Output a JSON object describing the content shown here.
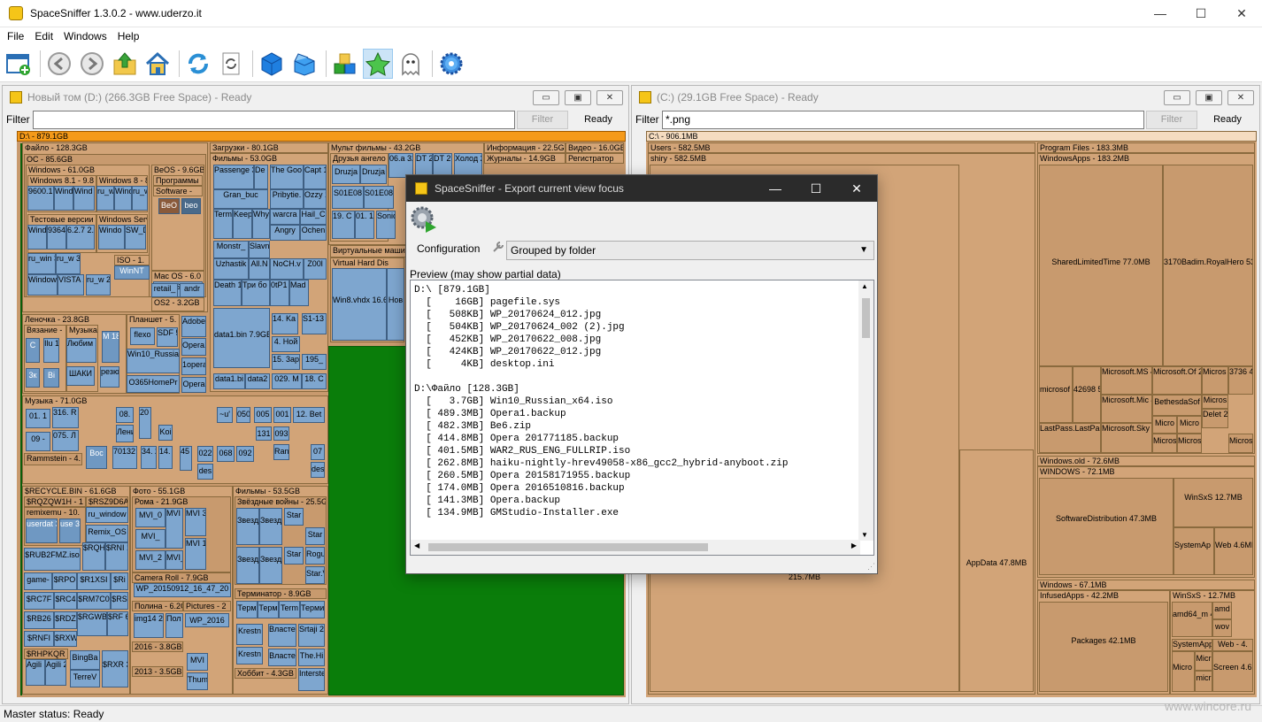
{
  "window": {
    "title": "SpaceSniffer 1.3.0.2 - www.uderzo.it",
    "minimize": "—",
    "maximize": "☐",
    "close": "✕"
  },
  "menu": [
    "File",
    "Edit",
    "Windows",
    "Help"
  ],
  "toolbar": {
    "icons": [
      "new-view-icon",
      "back-icon",
      "forward-icon",
      "up-folder-icon",
      "home-icon",
      "refresh-icon",
      "refresh-doc-icon",
      "blue-cube-icon",
      "blue-box-open-icon",
      "blocks-icon",
      "star-icon",
      "ghost-icon",
      "settings-gear-icon"
    ]
  },
  "left_panel": {
    "title": "Новый том (D:) (266.3GB Free Space) - Ready",
    "filter_label": "Filter",
    "filter_value": "",
    "filter_button": "Filter",
    "status": "Ready",
    "root": "D:\\ - 879.1GB",
    "blocks": [
      "Файло - 128.3GB",
      "OC - 85.6GB",
      "Windows - 61.0GB",
      "BeOS - 9.6GB",
      "Windows 8.1 - 9.8",
      "Windows 8 - 8.",
      "Программы",
      "Software -",
      "BeO",
      "beo",
      "9600.1 3.7GB",
      "Wind 3.0G",
      "Wind 2.9G",
      "ru_w 3.1G",
      "Wind 2.6G",
      "ru_w 3.0G",
      "Тестовые версии",
      "Windows Serve",
      "Windo 4.0GB",
      "SW_D 3.9GB",
      "Mac OS - 6.0",
      "MacOSX_10 4.6GB",
      "OS2 - 3.2GB",
      "Windows 2.8G",
      "9364 2.6G",
      "6.2.7 2.4G",
      "ru_win 3.4G",
      "ru_w 3.0G",
      "ISO - 1.",
      "WinNT",
      "retail_",
      "andr",
      "Windows 3.6GB",
      "VISTA 2.7G",
      "ru_w 2.3G",
      "Загрузки - 80.1GB",
      "Фильмы - 53.0GB",
      "Passenge 3.1GB",
      "De 2.1",
      "The Goo 1.9GB",
      "Capt 1.4G",
      "Gran_buc",
      "Pribytie.",
      "Ozzy 1.4G",
      "Term 2.1G",
      "Keep 2.1G",
      "Why 2.1G",
      "warcra",
      "Hail_C",
      "Angry",
      "Ochen",
      "Monstr_",
      "Slavn",
      "Uzhastik",
      "All.N",
      "NoCH.v",
      "Z00l",
      "Death 1.3GB",
      "Три бо 1.3GB",
      "0tP1 1.3GB",
      "Mad 1.3G",
      "data1.bin 7.9GB",
      "14. Ka 147.4",
      "S1-13 178.5",
      "4. Hoй",
      "15. 3ap",
      "195_",
      "data1.bi",
      "data2",
      "029. M",
      "18. C",
      "Мульт фильмы - 43.2GB",
      "Друзья ангело",
      "06.a 328",
      "DT 219",
      "DT 218",
      "Холод 2.1GB",
      "Druzja",
      "Druzja",
      "S01E08",
      "S01E08",
      "19. C 155.",
      "01. 153.",
      "Sonic 231.4",
      "Виртуальные машин",
      "Virtual Hard Dis",
      "Win8.vhdx 16.6GB",
      "Нов",
      "Информация - 22.5G",
      "Журналы - 14.9GB",
      "Видео - 16.0GB",
      "Регистратор",
      "Леночка - 23.8GB",
      "Вязание -",
      "Музыка",
      "Планшет - 5.",
      "Ilu 1.3",
      "Любим 268KB",
      "M 18",
      "flexo",
      "SDF 5.9M",
      "Win10_Russian 3.7GB",
      "1opera",
      "ШАКИ",
      "резю 84KB",
      "O365HomePr",
      "Opera",
      "Adobe 678.6",
      "Opera1",
      "Музыка - 71.0GB",
      "316. R 9.6MB",
      "01. 1",
      "075. Л 4.9MB",
      "09 -",
      "Rammstein - 4.",
      "Boc",
      "70132 1.8M",
      "34. 21",
      "14. 21",
      "08.",
      "Лени",
      "20 17",
      "Koi",
      "45 3.1",
      "022",
      "068",
      "092",
      "des",
      "~u'",
      "050",
      "005",
      "001",
      "12. Bet",
      "131",
      "093",
      "Ran",
      "07",
      "des",
      "$RECYCLE.BIN - 61.6GB",
      "$RQZQW1H - 1",
      "$RSZ9D6A",
      "remixemu - 10.",
      "ru_window",
      "userdat 3.8GB",
      "use 3.8",
      "Remix_OS",
      "$RUB2FMZ.iso",
      "$RQH 1.9G",
      "$RNI 1.9G",
      "game-",
      "$RPO",
      "$R1XSI",
      "$Ri",
      "$RC7F",
      "$RC4",
      "$RM7C0",
      "$RS",
      "$RB26",
      "$RDZ",
      "$RGWB 847MB",
      "$RF 636",
      "$RNFI",
      "$RXWL",
      "$RHPKQR",
      "Agili 3.0G",
      "Agili 2.9G",
      "BingBa",
      "TerreV",
      "$RXR 3.6GE",
      "Фото - 55.1GB",
      "Рома - 21.9GB",
      "MVI_0",
      "MVI_",
      "MVI 461",
      "MVI 339.6",
      "MVI_2",
      "MVI_",
      "MVI 197.8",
      "Camera Roll - 7.9GB",
      "WP_20150912_16_47_20",
      "Полина - 6.2G",
      "Pictures - 2",
      "img14 288KB",
      "Пол 12.",
      "WP_2016",
      "2016 - 3.8GB",
      "MVI",
      "2013 - 3.5GB",
      "Thum",
      "Фильмы - 53.5GB",
      "Звёздные войны - 25.5G",
      "Звезд 2.1GE",
      "Звезд 2.1GE",
      "Star",
      "Star",
      "Star",
      "Rogu",
      "Star.V",
      "Звезд 2.1GE",
      "Звезд 2.1GE",
      "Терминатор - 8.9GB",
      "Терм",
      "Терм",
      "Term",
      "Терми",
      "Krestn",
      "Власте 1.4GB",
      "Srtaji 2.1GB",
      "Krestn",
      "Власте",
      "The.Hi",
      "Хоббит - 4.3GB",
      "Interste 1.4GB"
    ]
  },
  "right_panel": {
    "title": "(C:) (29.1GB Free Space) - Ready",
    "filter_label": "Filter",
    "filter_value": "*.png",
    "filter_button": "Filter",
    "status": "Ready",
    "root": "C:\\ - 906.1MB",
    "blocks": [
      "Users - 582.5MB",
      "shiry - 582.5MB",
      "Program Files - 183.3MB",
      "WindowsApps - 183.2MB",
      "SharedLimitedTime 77.0MB",
      "3170Badim.RoyalHero 53.0MB",
      "microsof 6.0MB",
      "42698 5.1MB",
      "Microsoft.MS 4.4MB",
      "Microsoft.Of 2.9MB",
      "Micros 636KB",
      "3736 488K",
      "Microsoft.Mic 4.4MB",
      "BethesdaSof",
      "Micros",
      "Delet 280KI",
      "LastPass.LastPa 4.5MB",
      "Microsoft.Sky 4.1MB",
      "Micro",
      "Micro",
      "Micros",
      "Micros",
      "Micros",
      "Windows.old - 72.6MB",
      "WINDOWS - 72.1MB",
      "SoftwareDistribution 47.3MB",
      "WinSxS 12.7MB",
      "SystemAp 5.7MB",
      "Web 4.6MB",
      "Windows - 67.1MB",
      "InfusedApps - 42.2MB",
      "WinSxS - 12.7MB",
      "Packages 42.1MB",
      "amd64_m 4.6MB",
      "amd",
      "wov",
      "SystemApp",
      "Web - 4.",
      "Micro 2.2MI",
      "Micr",
      "micr",
      "Screen 4.6MB",
      "AppData 47.8MB",
      "215.7MB"
    ]
  },
  "dialog": {
    "title": "SpaceSniffer - Export current view focus",
    "config_label": "Configuration",
    "config_value": "Grouped by folder",
    "preview_label": "Preview (may show partial data)",
    "preview_lines": [
      "D:\\ [879.1GB]",
      "  [    16GB] pagefile.sys",
      "  [   508KB] WP_20170624_012.jpg",
      "  [   504KB] WP_20170624_002 (2).jpg",
      "  [   452KB] WP_20170622_008.jpg",
      "  [   424KB] WP_20170622_012.jpg",
      "  [     4KB] desktop.ini",
      "",
      "D:\\Файло [128.3GB]",
      "  [   3.7GB] Win10_Russian_x64.iso",
      "  [ 489.3MB] Opera1.backup",
      "  [ 482.3MB] Be6.zip",
      "  [ 414.8MB] Opera 201771185.backup",
      "  [ 401.5MB] WAR2_RUS_ENG_FULLRIP.iso",
      "  [ 262.8MB] haiku-nightly-hrev49058-x86_gcc2_hybrid-anyboot.zip",
      "  [ 260.5MB] Opera 20158171955.backup",
      "  [ 174.0MB] Opera 2016510816.backup",
      "  [ 141.3MB] Opera.backup",
      "  [ 134.9MB] GMStudio-Installer.exe"
    ]
  },
  "statusbar": "Master status: Ready",
  "watermark": "www.wincore.ru"
}
